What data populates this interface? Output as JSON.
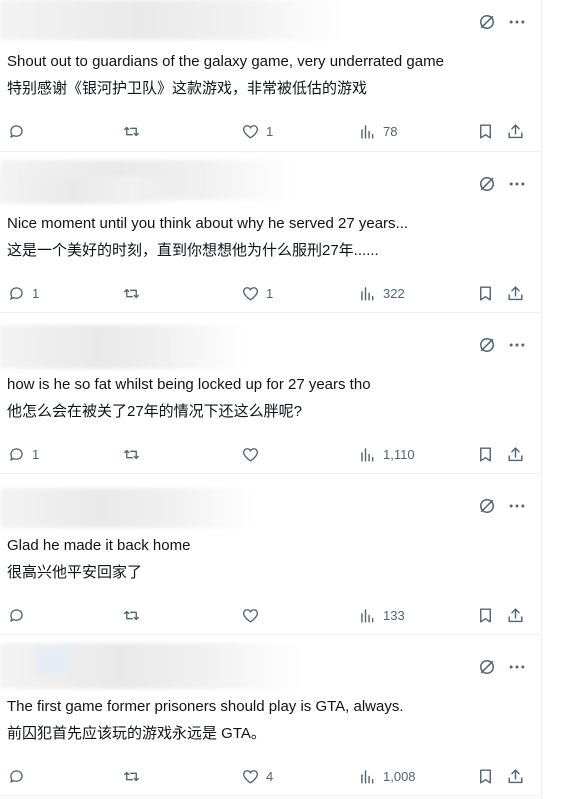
{
  "replies": [
    {
      "text_en": "Shout out to guardians of the galaxy game, very underrated game",
      "text_zh": "特别感谢《银河护卫队》这款游戏，非常被低估的游戏",
      "replies_count": "",
      "likes": "1",
      "views": "78"
    },
    {
      "text_en": "Nice moment until you think about why he served 27 years...",
      "text_zh": "这是一个美好的时刻，直到你想想他为什么服刑27年......",
      "replies_count": "1",
      "likes": "1",
      "views": "322"
    },
    {
      "text_en": "how is he so fat whilst being locked up for 27 years tho",
      "text_zh": "他怎么会在被关了27年的情况下还这么胖呢?",
      "replies_count": "1",
      "likes": "",
      "views": "1,110"
    },
    {
      "text_en": "Glad he made it back home",
      "text_zh": "很高兴他平安回家了",
      "replies_count": "",
      "likes": "",
      "views": "133"
    },
    {
      "text_en": "The first game former prisoners should play is GTA, always.",
      "text_zh": "前囚犯首先应该玩的游戏永远是 GTA。",
      "replies_count": "",
      "likes": "4",
      "views": "1,008"
    }
  ],
  "icons": {
    "grok": "grok-icon",
    "more": "more-icon",
    "reply": "reply-icon",
    "retweet": "retweet-icon",
    "like": "heart-icon",
    "views": "views-icon",
    "bookmark": "bookmark-icon",
    "share": "share-icon"
  },
  "colors": {
    "text": "#0f1419",
    "secondary": "#536471",
    "divider": "#eff3f4"
  }
}
